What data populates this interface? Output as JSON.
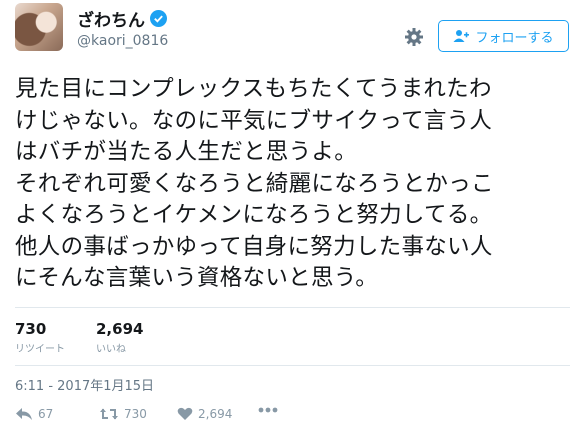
{
  "profile": {
    "display_name": "ざわちん",
    "handle": "@kaori_0816"
  },
  "follow_button": {
    "label": "フォローする"
  },
  "tweet": {
    "text": "見た目にコンプレックスもちたくてうまれたわ\nけじゃない。なのに平気にブサイクって言う人\nはバチが当たる人生だと思うよ。\nそれぞれ可愛くなろうと綺麗になろうとかっこ\nよくなろうとイケメンになろうと努力してる。\n他人の事ばっかゆって自身に努力した事ない人\nにそんな言葉いう資格ないと思う。"
  },
  "stats": {
    "retweets": {
      "count": "730",
      "label": "リツイート"
    },
    "likes": {
      "count": "2,694",
      "label": "いいね"
    }
  },
  "timestamp": "6:11 - 2017年1月15日",
  "actions": {
    "reply_count": "67",
    "retweet_count": "730",
    "like_count": "2,694"
  },
  "colors": {
    "accent": "#1da1f2",
    "muted": "#8899a6"
  }
}
